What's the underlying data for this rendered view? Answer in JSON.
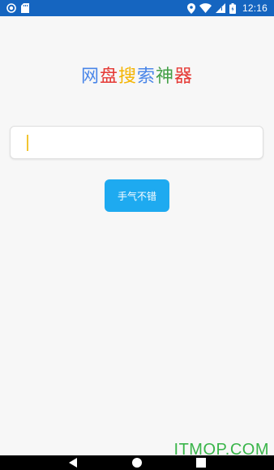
{
  "status_bar": {
    "time": "12:16",
    "background": "#1565c0",
    "icons_left": [
      "app-notification-icon",
      "sd-card-icon"
    ],
    "icons_right": [
      "location-icon",
      "wifi-icon",
      "signal-icon",
      "battery-icon"
    ]
  },
  "app": {
    "title_chars": [
      {
        "char": "网",
        "color": "#4a86e8"
      },
      {
        "char": "盘",
        "color": "#e53935"
      },
      {
        "char": "搜",
        "color": "#f4b400"
      },
      {
        "char": "索",
        "color": "#4a86e8"
      },
      {
        "char": "神",
        "color": "#43a047"
      },
      {
        "char": "器",
        "color": "#e53935"
      }
    ]
  },
  "search": {
    "value": "",
    "placeholder": "",
    "caret_color": "#f2c531"
  },
  "actions": {
    "lucky_label": "手气不错",
    "button_color": "#1eaaf0"
  },
  "watermark": {
    "text": "ITMOP.COM",
    "color": "#3ab54a"
  },
  "nav_bar": {
    "icons": [
      "back-icon",
      "home-icon",
      "recents-icon"
    ]
  }
}
